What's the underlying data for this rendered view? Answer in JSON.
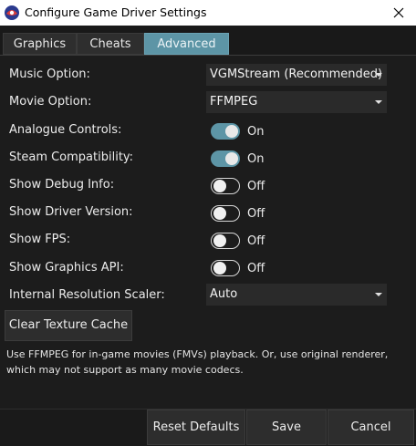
{
  "window": {
    "title": "Configure Game Driver Settings"
  },
  "tabs": [
    {
      "label": "Graphics"
    },
    {
      "label": "Cheats"
    },
    {
      "label": "Advanced"
    }
  ],
  "settings": {
    "music": {
      "label": "Music Option:",
      "value": "VGMStream (Recommended)"
    },
    "movie": {
      "label": "Movie Option:",
      "value": "FFMPEG"
    },
    "analogue": {
      "label": "Analogue Controls:",
      "state": "On"
    },
    "steam": {
      "label": "Steam Compatibility:",
      "state": "On"
    },
    "debug": {
      "label": "Show Debug Info:",
      "state": "Off"
    },
    "driver_version": {
      "label": "Show Driver Version:",
      "state": "Off"
    },
    "fps": {
      "label": "Show FPS:",
      "state": "Off"
    },
    "graphics_api": {
      "label": "Show Graphics API:",
      "state": "Off"
    },
    "resolution": {
      "label": "Internal Resolution Scaler:",
      "value": "Auto"
    }
  },
  "clear_cache_label": "Clear Texture Cache",
  "help_text": "Use FFMPEG for in-game movies (FMVs) playback. Or, use original renderer, which may not support as many movie codecs.",
  "footer": {
    "reset_label": "Reset Defaults",
    "save_label": "Save",
    "cancel_label": "Cancel"
  },
  "colors": {
    "accent": "#5d95a6",
    "background": "#1c1c1c",
    "titlebar": "#ffffff"
  }
}
